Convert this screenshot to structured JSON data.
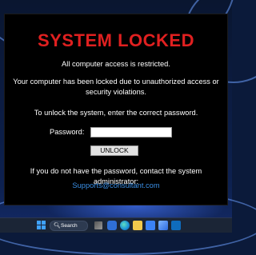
{
  "lock_screen": {
    "title": "SYSTEM LOCKED",
    "line1": "All computer access is restricted.",
    "line2": "Your computer has been locked due to unauthorized access or security violations.",
    "line3": "To unlock the system, enter the correct password.",
    "password_label": "Password:",
    "password_value": "",
    "unlock_label": "UNLOCK",
    "contact_text": "If you do not have the password, contact the system administrator:",
    "support_email": "Supports@consultant.com"
  },
  "taskbar": {
    "search_placeholder": "Search",
    "icons": [
      "windows-start-icon",
      "task-view-icon",
      "widgets-icon",
      "edge-icon",
      "file-explorer-icon",
      "microsoft-store-icon",
      "photos-icon",
      "outlook-icon"
    ]
  },
  "colors": {
    "title": "#e02020",
    "text": "#ffffff",
    "link": "#3a8fe6",
    "background": "#000000"
  }
}
